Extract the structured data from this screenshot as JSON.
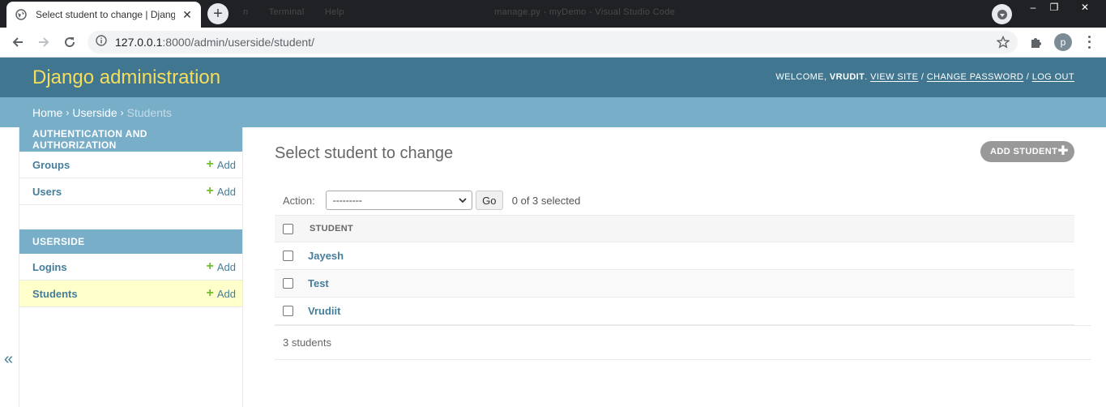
{
  "browser": {
    "tab_title": "Select student to change | Django",
    "new_tab": "+",
    "background_window_title": [
      "n",
      "Terminal",
      "Help",
      "manage.py - myDemo - Visual Studio Code"
    ],
    "url_host": "127.0.0.1",
    "url_path": ":8000/admin/userside/student/",
    "profile_initial": "p",
    "window_controls": [
      "–",
      "❐",
      "✕"
    ]
  },
  "header": {
    "branding": "Django administration",
    "welcome": "WELCOME, ",
    "username": "VRUDIT",
    "view_site": "VIEW SITE",
    "change_password": "CHANGE PASSWORD",
    "log_out": "LOG OUT",
    "separator": "/"
  },
  "breadcrumbs": {
    "home": "Home",
    "app": "Userside",
    "current": "Students",
    "sep": "›"
  },
  "sidebar": {
    "toggle": "«",
    "modules": [
      {
        "caption": "AUTHENTICATION AND AUTHORIZATION",
        "rows": [
          {
            "name": "Groups",
            "add": "Add"
          },
          {
            "name": "Users",
            "add": "Add"
          }
        ]
      },
      {
        "caption": "USERSIDE",
        "rows": [
          {
            "name": "Logins",
            "add": "Add"
          },
          {
            "name": "Students",
            "add": "Add"
          }
        ]
      }
    ]
  },
  "content": {
    "title": "Select student to change",
    "add_button": "ADD STUDENT",
    "action_label": "Action:",
    "action_value": "---------",
    "go": "Go",
    "counter": "0 of 3 selected",
    "column_header": "STUDENT",
    "rows": [
      "Jayesh",
      "Test",
      "Vrudiit"
    ],
    "paginator": "3 students"
  }
}
